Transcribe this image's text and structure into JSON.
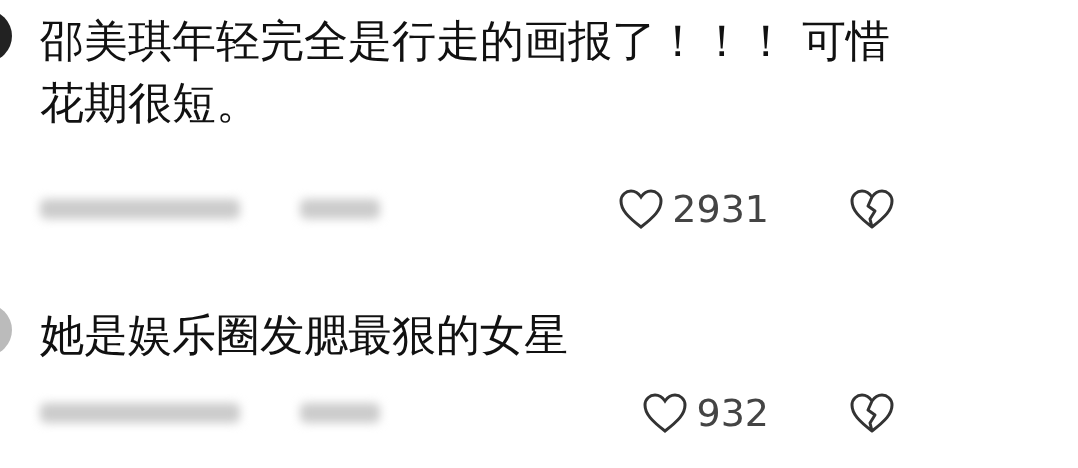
{
  "comments": [
    {
      "text": "邵美琪年轻完全是行走的画报了！！！ 可惜花期很短。",
      "likes": "2931"
    },
    {
      "text": "她是娱乐圈发腮最狠的女星",
      "likes": "932"
    }
  ]
}
